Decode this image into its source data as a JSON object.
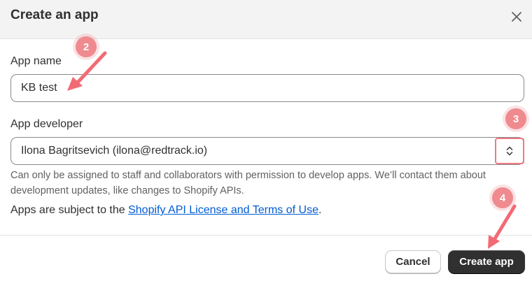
{
  "dialog": {
    "title": "Create an app",
    "close_icon": "close-icon"
  },
  "form": {
    "app_name_label": "App name",
    "app_name_value": "KB test",
    "app_developer_label": "App developer",
    "app_developer_value": "Ilona Bagritsevich (ilona@redtrack.io)",
    "developer_select_icon": "chevron-up-down-icon",
    "help_text": "Can only be assigned to staff and collaborators with permission to develop apps. We’ll contact them about development updates, like changes to Shopify APIs.",
    "terms_prefix": "Apps are subject to the ",
    "terms_link": "Shopify API License and Terms of Use",
    "terms_suffix": "."
  },
  "footer": {
    "cancel_label": "Cancel",
    "create_label": "Create app"
  },
  "annotations": {
    "step_2": "2",
    "step_3": "3",
    "step_4": "4",
    "color": "#ef8a8f"
  },
  "colors": {
    "primary_button": "#303030",
    "link": "#005bd3",
    "header_bg": "#f3f3f3"
  }
}
